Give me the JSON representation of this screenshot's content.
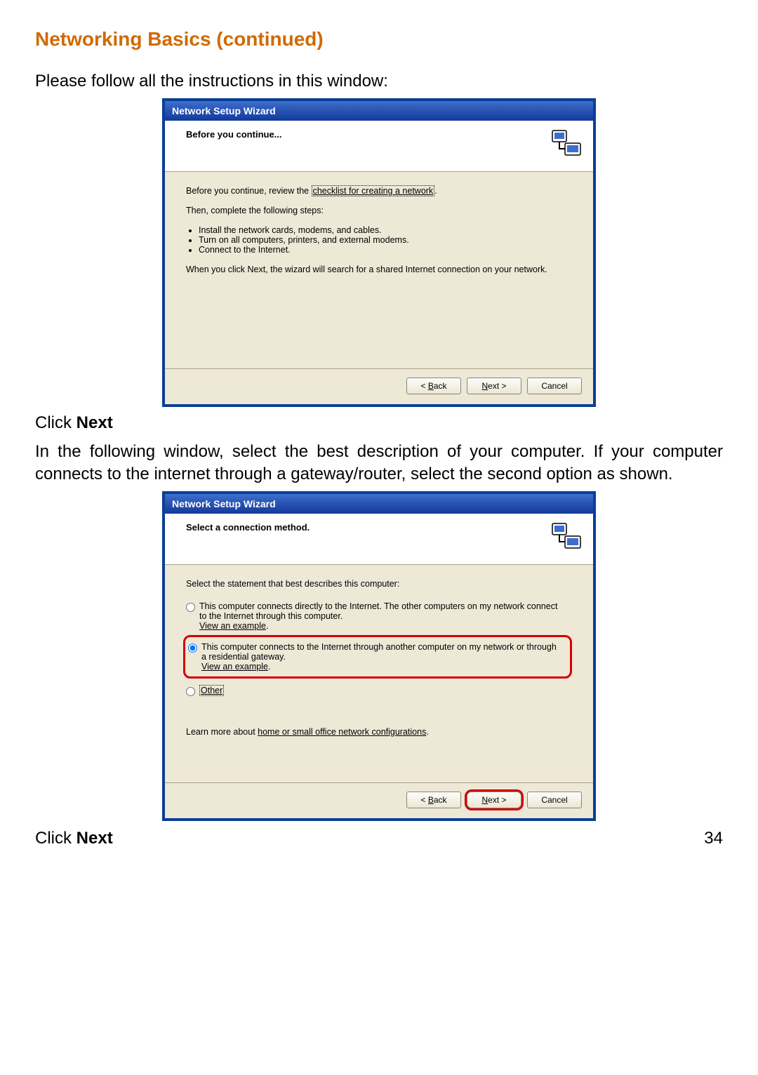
{
  "page": {
    "heading": "Networking Basics (continued)",
    "intro": "Please follow all the instructions in this window:",
    "click_next_1_pre": "Click ",
    "click_next_1_bold": "Next",
    "paragraph_2": "In the following window, select the best description of your computer. If your computer connects to the internet through a gateway/router, select the second option as shown.",
    "click_next_2_pre": "Click ",
    "click_next_2_bold": "Next",
    "page_number": "34"
  },
  "wizard1": {
    "title": "Network Setup Wizard",
    "header": "Before you continue...",
    "body": {
      "p1_pre": "Before you continue, review the ",
      "p1_link": "checklist for creating a network",
      "p1_post": ".",
      "p2": "Then, complete the following steps:",
      "li1": "Install the network cards, modems, and cables.",
      "li2": "Turn on all computers, printers, and external modems.",
      "li3": "Connect to the Internet.",
      "p3": "When you click Next, the wizard will search for a shared Internet connection on your network."
    },
    "buttons": {
      "back": "< Back",
      "next": "Next >",
      "cancel": "Cancel"
    }
  },
  "wizard2": {
    "title": "Network Setup Wizard",
    "header": "Select a connection method.",
    "body": {
      "p1": "Select the statement that best describes this computer:",
      "opt1_a": "This computer connects directly to the Internet. The other computers on my network connect to the Internet through this computer.",
      "opt1_link": "View an example",
      "opt2_a": "This computer connects to the Internet through another computer on my network or through a residential gateway.",
      "opt2_link": "View an example",
      "opt3": "Other",
      "learn_pre": "Learn more about ",
      "learn_link": "home or small office network configurations",
      "learn_post": "."
    },
    "buttons": {
      "back": "< Back",
      "next": "Next >",
      "cancel": "Cancel"
    }
  }
}
